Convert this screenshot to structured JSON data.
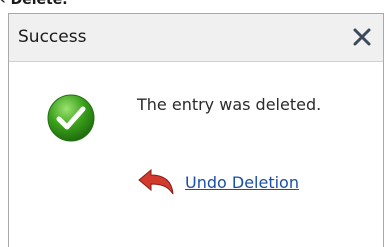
{
  "top_fragment": "‹ Delete.",
  "dialog": {
    "title": "Success",
    "close_glyph": "✕",
    "message": "The entry was deleted.",
    "undo_label": "Undo Deletion",
    "icons": {
      "status": "check-circle-icon",
      "close": "close-icon",
      "undo": "undo-arrow-icon"
    },
    "colors": {
      "link": "#1a4fa8",
      "success_green": "#3aa11c",
      "undo_red": "#d23a2e"
    }
  }
}
